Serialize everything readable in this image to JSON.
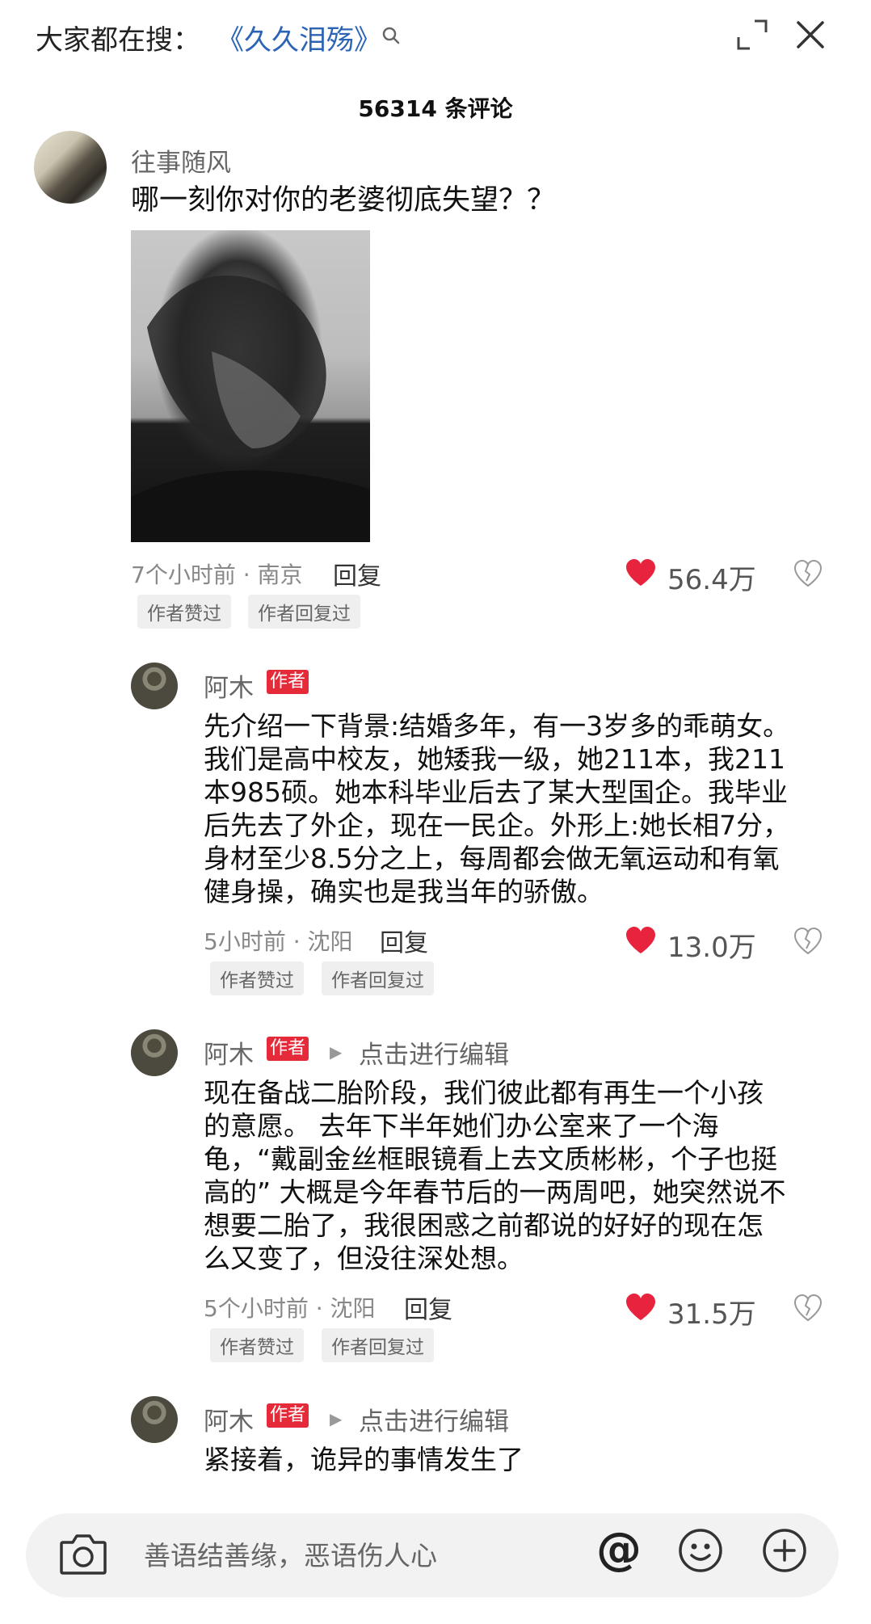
{
  "header": {
    "search_prefix": "大家都在搜：",
    "search_term": "《久久泪殇》",
    "comment_count": "56314 条评论"
  },
  "comments": [
    {
      "username": "往事随风",
      "text": "哪一刻你对你的老婆彻底失望？？",
      "meta": "7个小时前 · 南京",
      "reply": "回复",
      "likes": "56.4万",
      "tags": [
        "作者赞过",
        "作者回复过"
      ]
    },
    {
      "username": "阿木",
      "badge": "作者",
      "lines": [
        "先介绍一下背景:结婚多年，有一3岁多的乖萌女。",
        "我们是高中校友，她矮我一级，她211本，我211",
        "本985硕。她本科毕业后去了某大型国企。我毕业",
        "后先去了外企，现在一民企。外形上:她长相7分，",
        "身材至少8.5分之上，每周都会做无氧运动和有氧",
        "健身操，确实也是我当年的骄傲。"
      ],
      "meta": "5小时前 · 沈阳",
      "reply": "回复",
      "likes": "13.0万",
      "tags": [
        "作者赞过",
        "作者回复过"
      ]
    },
    {
      "username": "阿木",
      "badge": "作者",
      "edit": "点击进行编辑",
      "lines": [
        "现在备战二胎阶段，我们彼此都有再生一个小孩",
        "的意愿。 去年下半年她们办公室来了一个海",
        "龟，“戴副金丝框眼镜看上去文质彬彬，个子也挺",
        "高的” 大概是今年春节后的一两周吧，她突然说不",
        "想要二胎了，我很困惑之前都说的好好的现在怎",
        "么又变了，但没往深处想。"
      ],
      "meta": "5个小时前 · 沈阳",
      "reply": "回复",
      "likes": "31.5万",
      "tags": [
        "作者赞过",
        "作者回复过"
      ]
    },
    {
      "username": "阿木",
      "badge": "作者",
      "edit": "点击进行编辑",
      "text": "紧接着，诡异的事情发生了"
    }
  ],
  "input_bar": {
    "placeholder": "善语结善缘，恶语伤人心",
    "at_symbol": "@"
  },
  "colors": {
    "like_red": "#e8233d",
    "link_blue": "#2b63b5",
    "author_badge": "#e52a3a"
  }
}
